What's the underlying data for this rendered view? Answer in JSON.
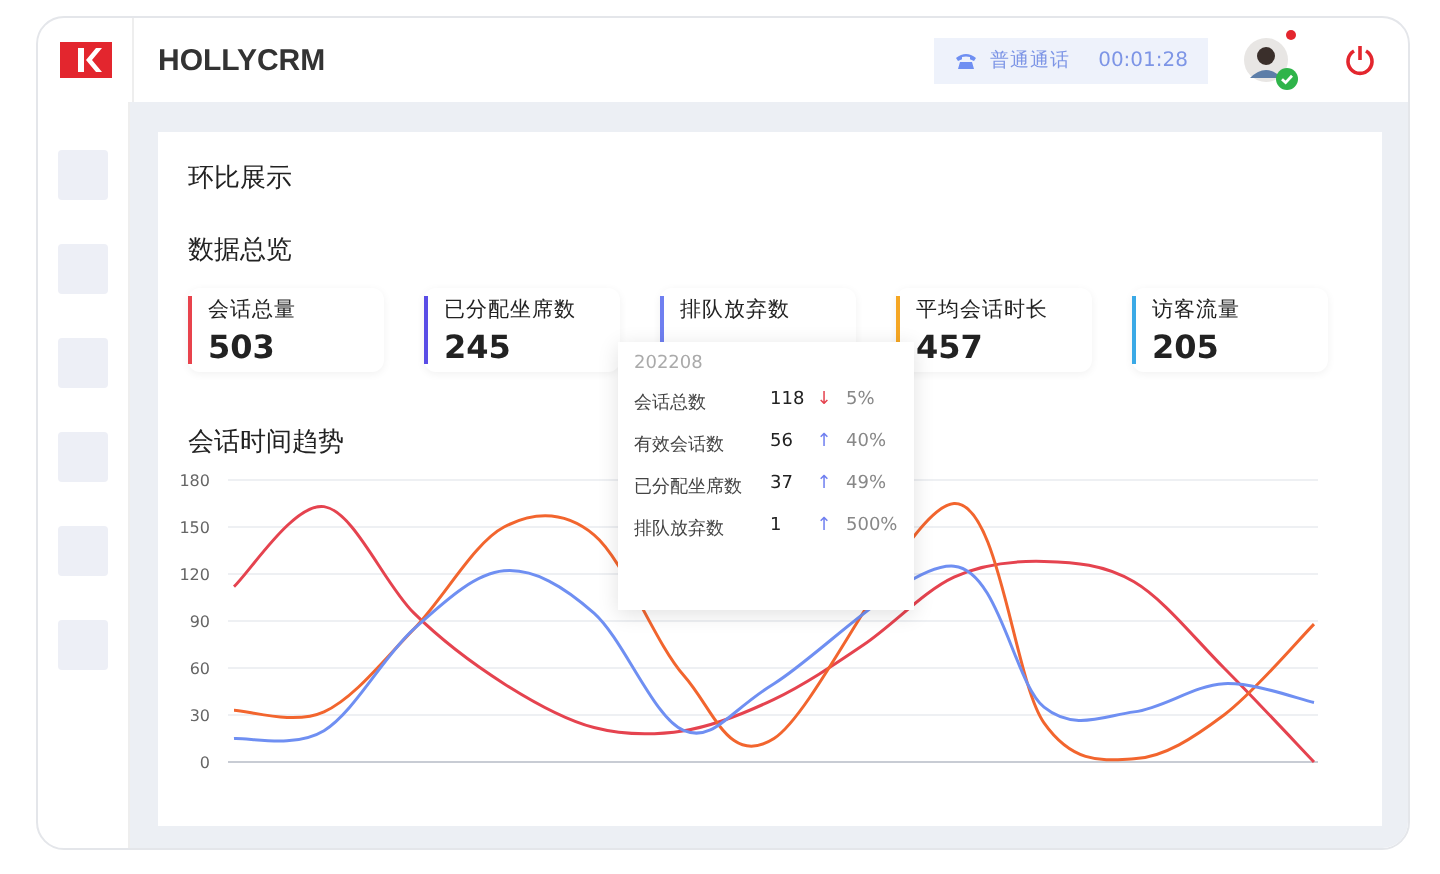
{
  "header": {
    "title": "HOLLYCRM",
    "call": {
      "label": "普通通话",
      "timer": "00:01:28"
    },
    "avatar": {
      "online": true,
      "notification": true
    }
  },
  "sidebar": {
    "items": [
      {
        "selected": false
      },
      {
        "selected": false
      },
      {
        "selected": false
      },
      {
        "selected": false
      },
      {
        "selected": false
      },
      {
        "selected": false
      }
    ]
  },
  "page": {
    "title": "环比展示",
    "overview_title": "数据总览",
    "stats": [
      {
        "label": "会话总量",
        "value": "503",
        "color": "#e8434c"
      },
      {
        "label": "已分配坐席数",
        "value": "245",
        "color": "#5a4de6"
      },
      {
        "label": "排队放弃数",
        "color": "#6f7ff0"
      },
      {
        "label": "平均会话时长",
        "value": "457",
        "color": "#f5a623"
      },
      {
        "label": "访客流量",
        "value": "205",
        "color": "#3aa9e6"
      }
    ],
    "trend_title": "会话时间趋势",
    "chart_data": {
      "type": "line",
      "grid": true,
      "ylim": [
        0,
        180
      ],
      "yticks": [
        0,
        30,
        60,
        90,
        120,
        150,
        180
      ],
      "series": [
        {
          "color": "#e5434f",
          "values": [
            112,
            163,
            95,
            50,
            22,
            20,
            40,
            75,
            118,
            128,
            115,
            60,
            0
          ]
        },
        {
          "color": "#f2652e",
          "values": [
            33,
            32,
            85,
            150,
            145,
            55,
            15,
            null,
            165,
            25,
            2,
            30,
            88
          ]
        },
        {
          "color": "#6f8ff2",
          "values": [
            15,
            20,
            85,
            122,
            95,
            20,
            50,
            null,
            125,
            35,
            32,
            50,
            38
          ]
        }
      ]
    },
    "tooltip": {
      "title": "202208",
      "rows": [
        {
          "label": "会话总数",
          "value": "118",
          "arrow": "↓",
          "color": "#e5434f",
          "percent": "5%"
        },
        {
          "label": "有效会话数",
          "value": "56",
          "arrow": "↑",
          "color": "#6f7ff0",
          "percent": "40%"
        },
        {
          "label": "已分配坐席数",
          "value": "37",
          "arrow": "↑",
          "color": "#6f7ff0",
          "percent": "49%"
        },
        {
          "label": "排队放弃数",
          "value": "1",
          "arrow": "↑",
          "color": "#6f7ff0",
          "percent": "500%"
        }
      ]
    }
  }
}
